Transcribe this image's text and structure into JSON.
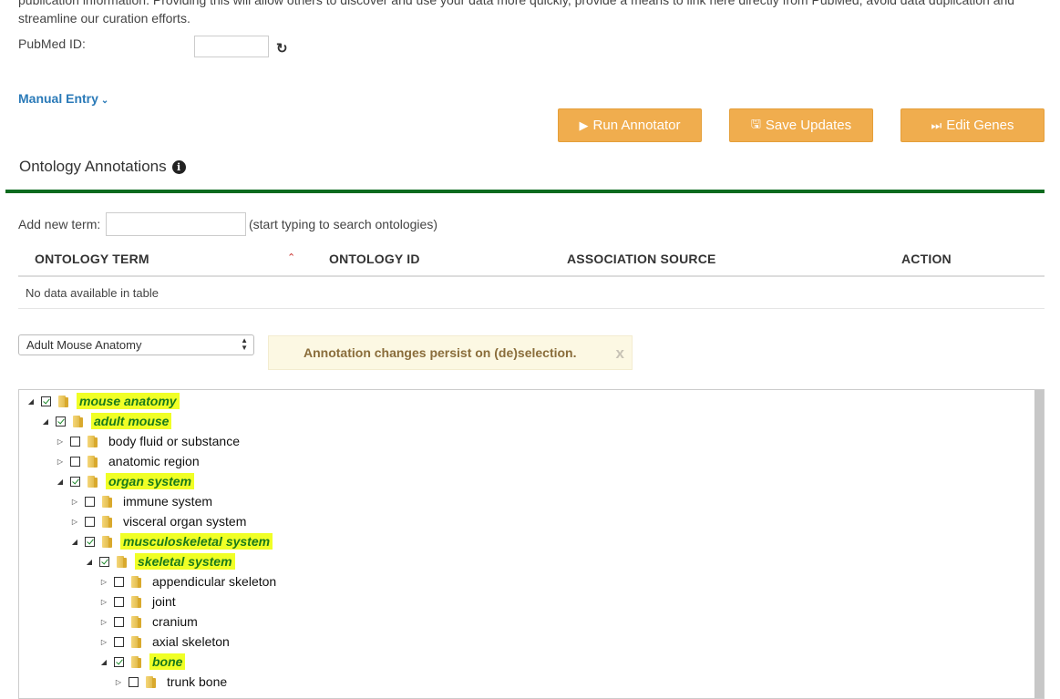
{
  "intro_text": "publication information. Providing this will allow others to discover and use your data more quickly, provide a means to link here directly from PubMed, avoid data duplication and streamline our curation efforts.",
  "pubmed": {
    "label": "PubMed ID:",
    "value": ""
  },
  "manual_entry": {
    "label": "Manual Entry"
  },
  "buttons": {
    "run_annotator": "Run Annotator",
    "save_updates": "Save Updates",
    "edit_genes": "Edit Genes"
  },
  "section_title": "Ontology Annotations",
  "add_term": {
    "label": "Add new term:",
    "value": "",
    "hint": "(start typing to search ontologies)"
  },
  "table": {
    "headers": [
      "ONTOLOGY TERM",
      "ONTOLOGY ID",
      "ASSOCIATION SOURCE",
      "ACTION"
    ],
    "empty_message": "No data available in table"
  },
  "ontology_select": {
    "selected": "Adult Mouse Anatomy"
  },
  "alert": {
    "message": "Annotation changes persist on (de)selection.",
    "close": "x"
  },
  "tree": {
    "nodes": [
      {
        "label": "mouse anatomy",
        "depth": 0,
        "expanded": true,
        "checked": true
      },
      {
        "label": "adult mouse",
        "depth": 1,
        "expanded": true,
        "checked": true
      },
      {
        "label": "body fluid or substance",
        "depth": 2,
        "expanded": false,
        "checked": false
      },
      {
        "label": "anatomic region",
        "depth": 2,
        "expanded": false,
        "checked": false
      },
      {
        "label": "organ system",
        "depth": 2,
        "expanded": true,
        "checked": true
      },
      {
        "label": "immune system",
        "depth": 3,
        "expanded": false,
        "checked": false
      },
      {
        "label": "visceral organ system",
        "depth": 3,
        "expanded": false,
        "checked": false
      },
      {
        "label": "musculoskeletal system",
        "depth": 3,
        "expanded": true,
        "checked": true
      },
      {
        "label": "skeletal system",
        "depth": 4,
        "expanded": true,
        "checked": true
      },
      {
        "label": "appendicular skeleton",
        "depth": 5,
        "expanded": false,
        "checked": false
      },
      {
        "label": "joint",
        "depth": 5,
        "expanded": false,
        "checked": false
      },
      {
        "label": "cranium",
        "depth": 5,
        "expanded": false,
        "checked": false
      },
      {
        "label": "axial skeleton",
        "depth": 5,
        "expanded": false,
        "checked": false
      },
      {
        "label": "bone",
        "depth": 5,
        "expanded": true,
        "checked": true
      },
      {
        "label": "trunk bone",
        "depth": 6,
        "expanded": false,
        "checked": false
      }
    ]
  },
  "colors": {
    "accent_orange": "#f0ad4e",
    "divider_green": "#0b6b1e",
    "link_blue": "#2a7ab8",
    "highlight_yellow": "#f0ff26"
  }
}
